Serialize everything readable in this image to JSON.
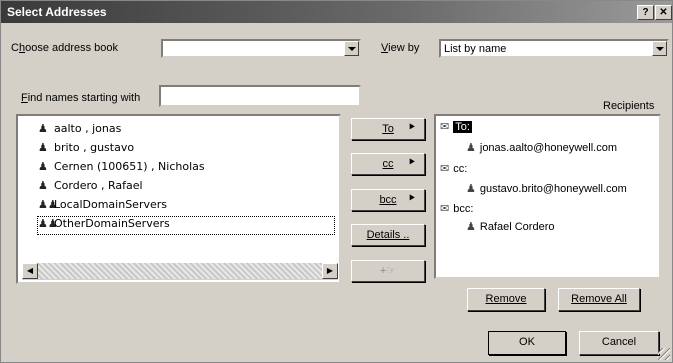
{
  "window": {
    "title": "Select Addresses",
    "help_button": "?",
    "close_button": "✕"
  },
  "address_book": {
    "label_pre": "C",
    "label_ul": "h",
    "label_post": "oose address book",
    "value": ""
  },
  "view_by": {
    "label_ul": "V",
    "label_post": "iew by",
    "value": "List by name"
  },
  "find": {
    "label_ul": "F",
    "label_post": "ind names starting with",
    "value": ""
  },
  "names": [
    {
      "text": "aalto , jonas",
      "icon": "person-icon"
    },
    {
      "text": "brito , gustavo",
      "icon": "person-icon"
    },
    {
      "text": "Cernen (100651) , Nicholas",
      "icon": "person-icon"
    },
    {
      "text": "Cordero , Rafael",
      "icon": "person-icon"
    },
    {
      "text": "LocalDomainServers",
      "icon": "group-icon"
    },
    {
      "text": "OtherDomainServers",
      "icon": "group-icon"
    }
  ],
  "buttons": {
    "to": "To",
    "cc": "cc",
    "bcc": "bcc",
    "details": "Details ..",
    "add_group": "+",
    "remove": "Remove",
    "remove_all": "Remove All",
    "ok": "OK",
    "cancel": "Cancel"
  },
  "recipients": {
    "label": "Recipients",
    "to_header": "To:",
    "to_entry": "jonas.aalto@honeywell.com",
    "cc_header": "cc:",
    "cc_entry": "gustavo.brito@honeywell.com",
    "bcc_header": "bcc:",
    "bcc_entry": "Rafael Cordero"
  }
}
